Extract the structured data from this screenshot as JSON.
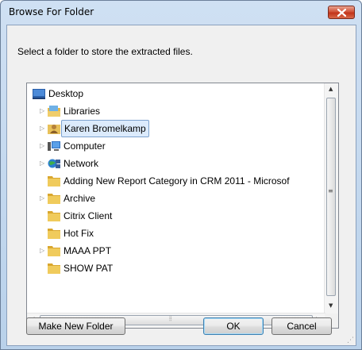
{
  "window": {
    "title": "Browse For Folder"
  },
  "instruction": "Select a folder to store the extracted files.",
  "tree": {
    "items": [
      {
        "label": "Desktop",
        "icon": "desktop-icon",
        "expandable": false
      },
      {
        "label": "Libraries",
        "icon": "libraries-icon",
        "expandable": true
      },
      {
        "label": "Karen Bromelkamp",
        "icon": "user-folder-icon",
        "expandable": true,
        "selected": true
      },
      {
        "label": "Computer",
        "icon": "computer-icon",
        "expandable": true
      },
      {
        "label": "Network",
        "icon": "network-icon",
        "expandable": true
      },
      {
        "label": "Adding New Report Category in CRM 2011 - Microsof",
        "icon": "folder-icon",
        "expandable": false
      },
      {
        "label": "Archive",
        "icon": "folder-icon",
        "expandable": true
      },
      {
        "label": "Citrix Client",
        "icon": "folder-icon",
        "expandable": false
      },
      {
        "label": "Hot Fix",
        "icon": "folder-icon",
        "expandable": false
      },
      {
        "label": "MAAA PPT",
        "icon": "folder-icon",
        "expandable": true
      },
      {
        "label": "SHOW PAT",
        "icon": "folder-icon",
        "expandable": false
      }
    ]
  },
  "buttons": {
    "make_new_folder": "Make New Folder",
    "ok": "OK",
    "cancel": "Cancel"
  },
  "colors": {
    "selection": "#dcebfc",
    "folder": "#e8c15a",
    "close_button": "#c9442a"
  }
}
